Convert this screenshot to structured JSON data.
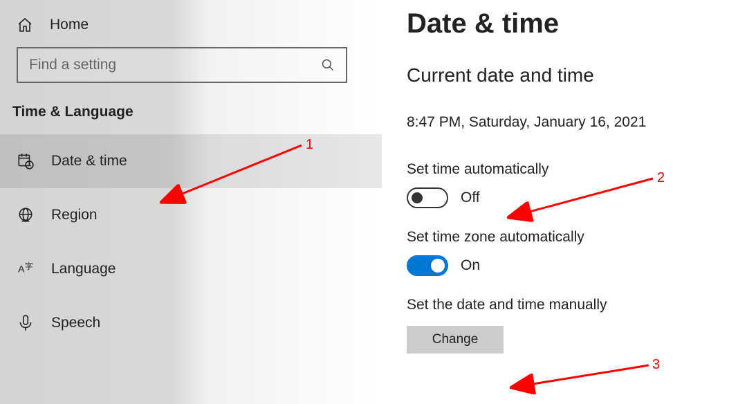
{
  "sidebar": {
    "home_label": "Home",
    "search_placeholder": "Find a setting",
    "category_title": "Time & Language",
    "items": [
      {
        "label": "Date & time",
        "icon": "calendar-clock-icon",
        "active": true
      },
      {
        "label": "Region",
        "icon": "globe-icon",
        "active": false
      },
      {
        "label": "Language",
        "icon": "language-character-icon",
        "active": false
      },
      {
        "label": "Speech",
        "icon": "microphone-icon",
        "active": false
      }
    ]
  },
  "content": {
    "page_title": "Date & time",
    "section_title": "Current date and time",
    "current_datetime": "8:47 PM, Saturday, January 16, 2021",
    "set_time_auto_label": "Set time automatically",
    "set_time_auto_state": "Off",
    "set_tz_auto_label": "Set time zone automatically",
    "set_tz_auto_state": "On",
    "manual_label": "Set the date and time manually",
    "change_button_label": "Change"
  },
  "annotations": {
    "one": "1",
    "two": "2",
    "three": "3"
  }
}
